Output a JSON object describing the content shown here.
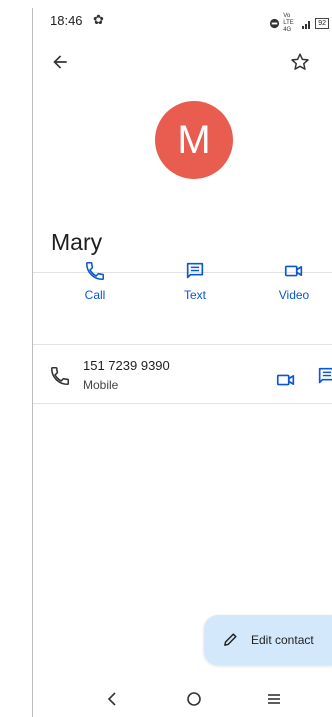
{
  "status_bar": {
    "time": "18:46",
    "network": "Vo LTE 4G",
    "battery": "92"
  },
  "contact": {
    "initial": "M",
    "name": "Mary",
    "avatar_color": "#e85d50"
  },
  "actions": [
    {
      "label": "Call",
      "icon": "phone-icon"
    },
    {
      "label": "Text",
      "icon": "message-icon"
    },
    {
      "label": "Video",
      "icon": "video-icon"
    }
  ],
  "phone_entry": {
    "number": "151 7239 9390",
    "type": "Mobile"
  },
  "fab": {
    "label": "Edit contact",
    "icon": "pencil-icon"
  },
  "colors": {
    "accent": "#0b57d0",
    "fab_bg": "#d3e9fb"
  }
}
